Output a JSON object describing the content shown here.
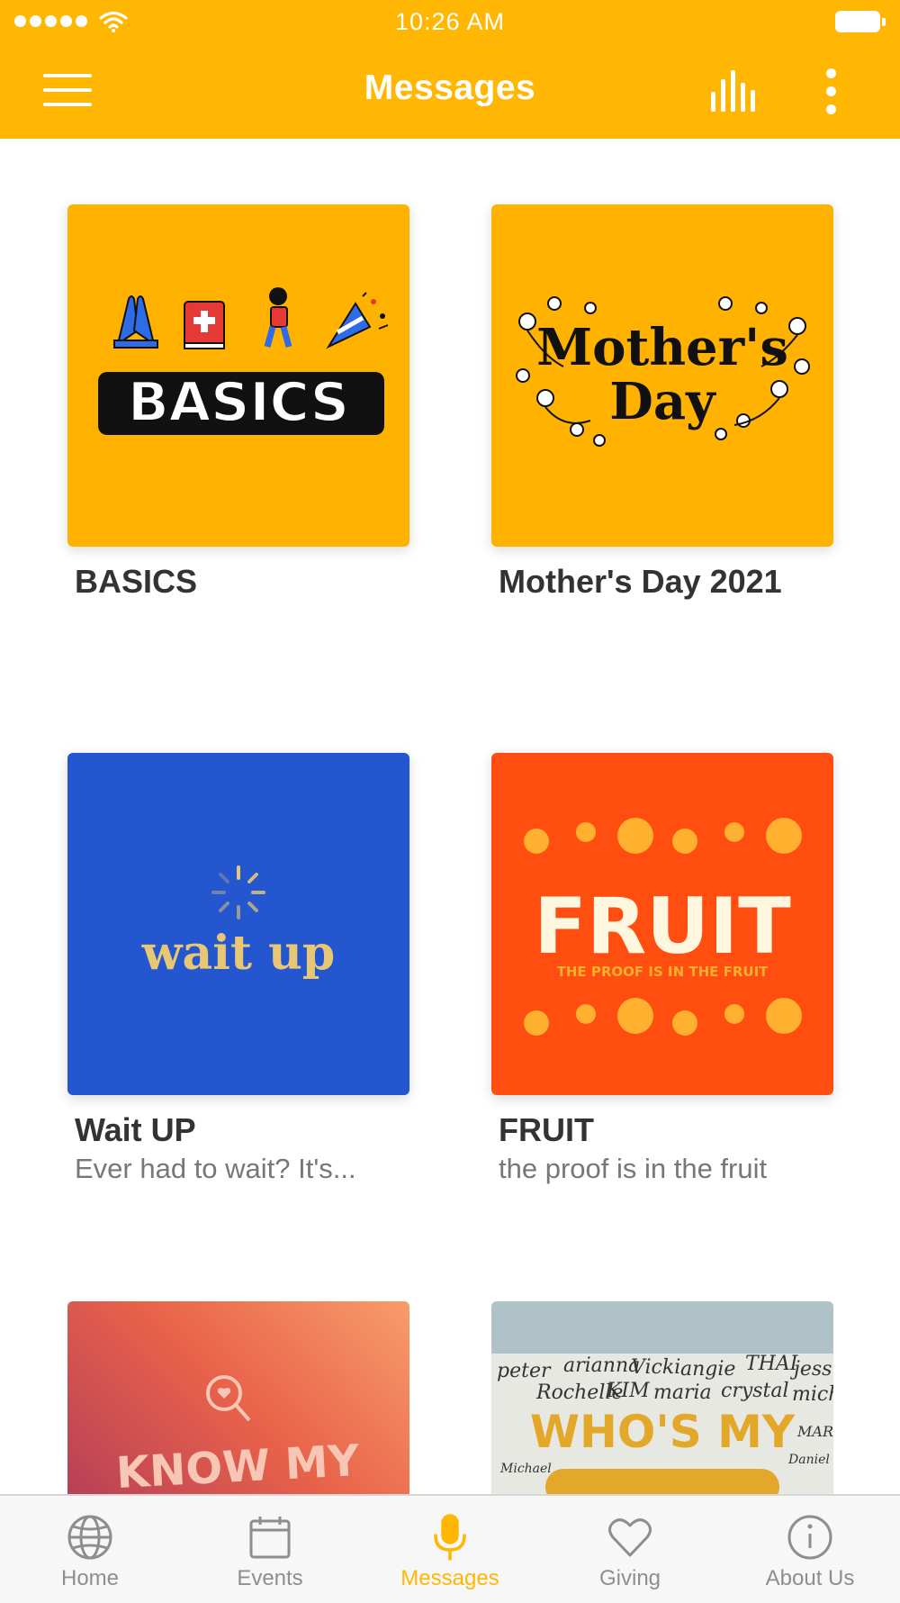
{
  "status_bar": {
    "time": "10:26 AM"
  },
  "header": {
    "title": "Messages"
  },
  "accent_color": "#FFB703",
  "cards": [
    {
      "title": "BASICS",
      "subtitle": "",
      "art_text": "BASICS",
      "bg": "#FFB300"
    },
    {
      "title": "Mother's Day 2021",
      "subtitle": "",
      "art_text_1": "Mother's",
      "art_text_2": "Day",
      "bg": "#FFB300"
    },
    {
      "title": "Wait UP",
      "subtitle": "Ever had to wait? It's...",
      "art_text": "wait up",
      "bg": "#2456D0"
    },
    {
      "title": "FRUIT",
      "subtitle": "the proof is in the fruit",
      "art_text": "FRUIT",
      "art_tagline": "THE PROOF IS IN THE FRUIT",
      "bg": "#FF4E10"
    },
    {
      "title": "",
      "subtitle": "",
      "art_text": "KNOW MY",
      "bg": "#E0623F"
    },
    {
      "title": "",
      "subtitle": "",
      "art_text": "WHO'S MY",
      "art_names": [
        "peter",
        "arianna",
        "Vicki",
        "angie",
        "THAI",
        "jess",
        "Rochelle",
        "KIM",
        "maria",
        "crystal",
        "michelle",
        "Michael",
        "MARK",
        "Daniel"
      ],
      "bg": "#E8E8E2"
    }
  ],
  "tabs": [
    {
      "label": "Home",
      "icon": "globe-icon"
    },
    {
      "label": "Events",
      "icon": "calendar-icon"
    },
    {
      "label": "Messages",
      "icon": "microphone-icon",
      "active": true
    },
    {
      "label": "Giving",
      "icon": "heart-icon"
    },
    {
      "label": "About Us",
      "icon": "info-icon"
    }
  ]
}
